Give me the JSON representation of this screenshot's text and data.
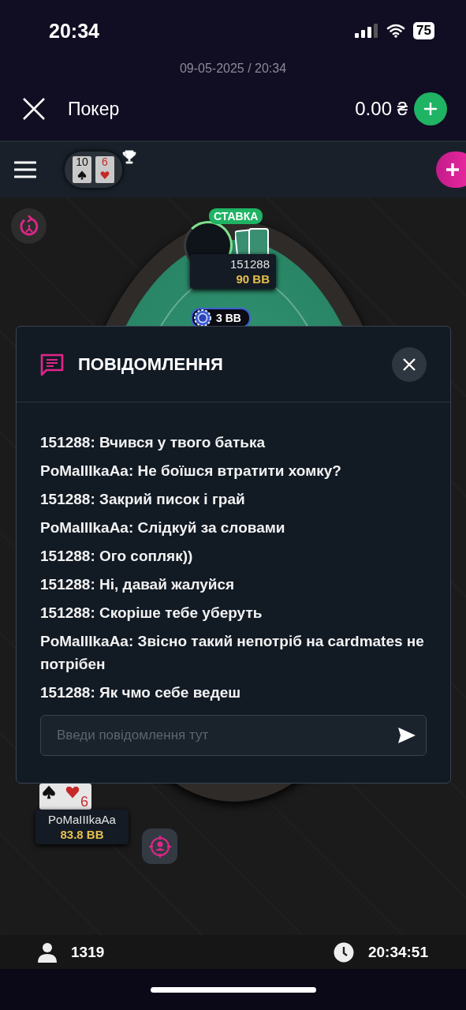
{
  "status_bar": {
    "time": "20:34",
    "battery": "75"
  },
  "date_line": "09-05-2025 / 20:34",
  "header": {
    "title": "Покер",
    "balance": "0.00 ₴"
  },
  "toolbar": {
    "hand_cards": [
      {
        "rank": "10",
        "kind": "spade"
      },
      {
        "rank": "6",
        "kind": "heart"
      }
    ]
  },
  "table": {
    "top_seat": {
      "badge": "СТАВКА",
      "name": "151288",
      "stack": "90 BB"
    },
    "pot": "3 BB",
    "bottom_seat": {
      "name": "PoMaIIIkaAa",
      "stack": "83.8 BB",
      "cards": [
        {
          "kind": "spade"
        },
        {
          "rank": "6",
          "kind": "heart"
        }
      ]
    }
  },
  "chat": {
    "title": "ПОВІДОМЛЕННЯ",
    "messages": [
      "151288: Вчився у твого батька",
      "PoMaIIIkaAa: Не боїшся втратити хомку?",
      "151288: Закрий писок і грай",
      "PoMaIIIkaAa: Слідкуй за словами",
      "151288: Ого сопляк))",
      "151288: Ні, давай жалуйся",
      "151288: Скоріше тебе уберуть",
      "PoMaIIIkaAa: Звісно такий непотріб на cardmates не потрібен",
      "151288: Як чмо себе ведеш"
    ],
    "placeholder": "Введи повідомлення тут"
  },
  "footer": {
    "players": "1319",
    "clock": "20:34:51"
  }
}
